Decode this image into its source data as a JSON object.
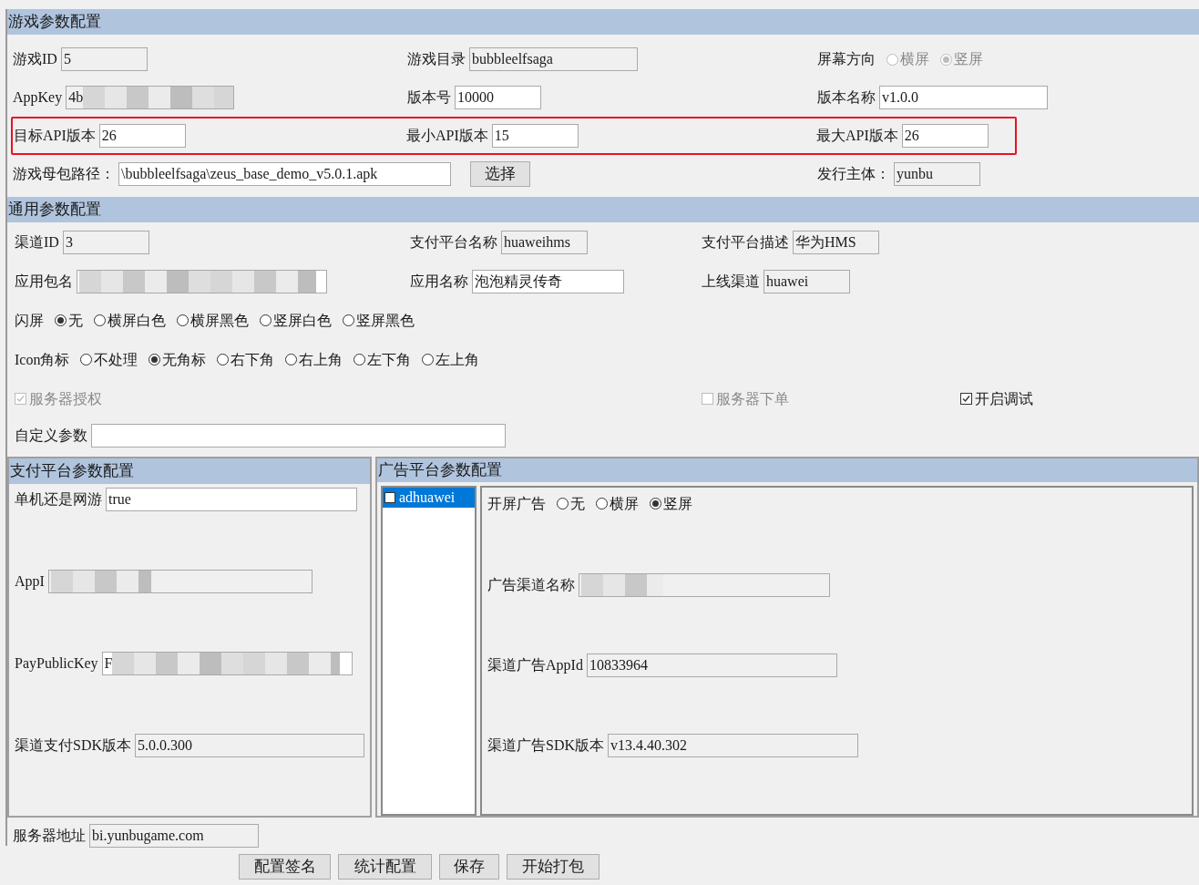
{
  "game_section": {
    "title": "游戏参数配置",
    "rows": [
      {
        "highlighted": false,
        "items": [
          {
            "kind": "field",
            "label": "游戏ID",
            "value": "5",
            "editable": false
          },
          {
            "kind": "field",
            "label": "游戏目录",
            "value": "bubbleelfsaga",
            "editable": false
          },
          {
            "kind": "radio_group",
            "label": "屏幕方向",
            "disabled": true,
            "options": [
              {
                "label": "横屏",
                "selected": false
              },
              {
                "label": "竖屏",
                "selected": true
              }
            ]
          }
        ]
      },
      {
        "highlighted": false,
        "items": [
          {
            "kind": "masked_field",
            "label": "AppKey",
            "value": "4b",
            "editable": false
          },
          {
            "kind": "field",
            "label": "版本号",
            "value": "10000",
            "editable": true
          },
          {
            "kind": "field",
            "label": "版本名称",
            "value": "v1.0.0",
            "editable": true
          }
        ]
      },
      {
        "highlighted": true,
        "items": [
          {
            "kind": "field",
            "label": "目标API版本",
            "value": "26",
            "editable": true
          },
          {
            "kind": "field",
            "label": "最小API版本",
            "value": "15",
            "editable": true
          },
          {
            "kind": "field",
            "label": "最大API版本",
            "value": "26",
            "editable": true
          }
        ]
      },
      {
        "highlighted": false,
        "items": [
          {
            "kind": "field",
            "label": "游戏母包路径：",
            "value": "\\bubbleelfsaga\\zeus_base_demo_v5.0.1.apk",
            "editable": true
          },
          {
            "kind": "button",
            "label": "选择"
          },
          {
            "kind": "field",
            "label": "发行主体：",
            "value": "yunbu",
            "editable": false
          }
        ]
      }
    ]
  },
  "general_section": {
    "title": "通用参数配置",
    "rows": [
      [
        {
          "kind": "field",
          "label": "渠道ID",
          "value": "3",
          "editable": false
        },
        {
          "kind": "field",
          "label": "支付平台名称",
          "value": "huaweihms",
          "editable": false
        },
        {
          "kind": "field",
          "label": "支付平台描述",
          "value": "华为HMS",
          "editable": false
        }
      ],
      [
        {
          "kind": "masked_field",
          "label": "应用包名",
          "editable": true
        },
        {
          "kind": "field",
          "label": "应用名称",
          "value": "泡泡精灵传奇",
          "editable": true
        },
        {
          "kind": "field",
          "label": "上线渠道",
          "value": "huawei",
          "editable": false
        }
      ],
      [
        {
          "kind": "radio_group",
          "label": "闪屏",
          "disabled": false,
          "options": [
            {
              "label": "无",
              "selected": true
            },
            {
              "label": "横屏白色",
              "selected": false
            },
            {
              "label": "横屏黑色",
              "selected": false
            },
            {
              "label": "竖屏白色",
              "selected": false
            },
            {
              "label": "竖屏黑色",
              "selected": false
            }
          ]
        }
      ],
      [
        {
          "kind": "radio_group",
          "label": "Icon角标",
          "disabled": false,
          "options": [
            {
              "label": "不处理",
              "selected": false
            },
            {
              "label": "无角标",
              "selected": true
            },
            {
              "label": "右下角",
              "selected": false
            },
            {
              "label": "右上角",
              "selected": false
            },
            {
              "label": "左下角",
              "selected": false
            },
            {
              "label": "左上角",
              "selected": false
            }
          ]
        }
      ],
      [
        {
          "kind": "checkbox",
          "label": "服务器授权",
          "checked": true,
          "disabled": true
        },
        "",
        {
          "kind": "checkbox",
          "label": "服务器下单",
          "checked": false,
          "disabled": true
        },
        {
          "kind": "checkbox",
          "label": "开启调试",
          "checked": true,
          "disabled": false
        }
      ],
      [
        {
          "kind": "field",
          "label": "自定义参数",
          "editable": true
        }
      ]
    ]
  },
  "pay_panel": {
    "title": "支付平台参数配置",
    "rows": [
      {
        "kind": "field",
        "label": "单机还是网游",
        "value": "true",
        "editable": true
      },
      {
        "kind": "masked_field",
        "label": "AppI",
        "editable": false
      },
      {
        "kind": "masked_field",
        "label": "PayPublicKey",
        "value": "F",
        "editable": true
      },
      {
        "kind": "field",
        "label": "渠道支付SDK版本",
        "value": "5.0.0.300",
        "editable": false
      }
    ]
  },
  "ad_panel": {
    "title": "广告平台参数配置",
    "platforms": [
      {
        "label": "adhuawei",
        "selected": true,
        "checked": false
      }
    ],
    "rows": [
      {
        "kind": "radio_group",
        "label": "开屏广告",
        "disabled": false,
        "options": [
          {
            "label": "无",
            "selected": false
          },
          {
            "label": "横屏",
            "selected": false
          },
          {
            "label": "竖屏",
            "selected": true
          }
        ]
      },
      {
        "kind": "masked_field",
        "label": "广告渠道名称",
        "editable": false
      },
      {
        "kind": "field",
        "label": "渠道广告AppId",
        "value": "10833964",
        "editable": false
      },
      {
        "kind": "field",
        "label": "渠道广告SDK版本",
        "value": "v13.4.40.302",
        "editable": false
      }
    ]
  },
  "server_address": {
    "kind": "field",
    "label": "服务器地址",
    "value": "bi.yunbugame.com",
    "editable": false
  },
  "buttons": [
    "配置签名",
    "统计配置",
    "保存",
    "开始打包"
  ]
}
